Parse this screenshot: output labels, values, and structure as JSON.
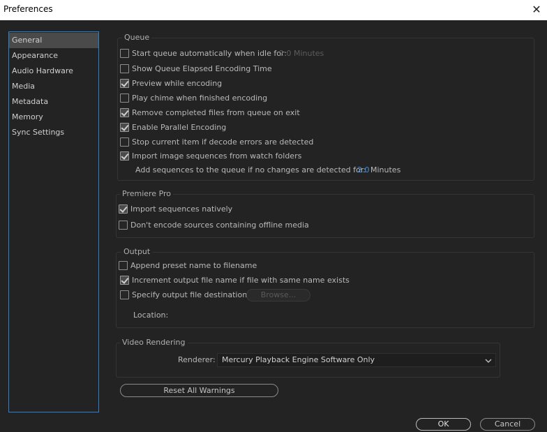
{
  "window": {
    "title": "Preferences",
    "close_glyph": "✕"
  },
  "sidebar": {
    "items": [
      {
        "label": "General",
        "active": true
      },
      {
        "label": "Appearance"
      },
      {
        "label": "Audio Hardware"
      },
      {
        "label": "Media"
      },
      {
        "label": "Metadata"
      },
      {
        "label": "Memory"
      },
      {
        "label": "Sync Settings"
      }
    ]
  },
  "queue": {
    "title": "Queue",
    "start_auto": {
      "label": "Start queue automatically when idle for:",
      "checked": false,
      "value": "2.0 Minutes"
    },
    "show_elapsed": {
      "label": "Show Queue Elapsed Encoding Time",
      "checked": false
    },
    "preview": {
      "label": "Preview while encoding",
      "checked": true
    },
    "chime": {
      "label": "Play chime when finished encoding",
      "checked": false
    },
    "remove_completed": {
      "label": "Remove completed files from queue on exit",
      "checked": true
    },
    "parallel": {
      "label": "Enable Parallel Encoding",
      "checked": true
    },
    "stop_current": {
      "label": "Stop current item if decode errors are detected",
      "checked": false
    },
    "import_watch": {
      "label": "Import image sequences from watch folders",
      "checked": true
    },
    "add_sequences": {
      "label": "Add sequences to the queue if no changes are detected for:",
      "value": "2.0",
      "unit": "Minutes"
    }
  },
  "premiere": {
    "title": "Premiere Pro",
    "import_native": {
      "label": "Import sequences natively",
      "checked": true
    },
    "dont_encode": {
      "label": "Don't encode sources containing offline media",
      "checked": false
    }
  },
  "output": {
    "title": "Output",
    "append_preset": {
      "label": "Append preset name to filename",
      "checked": false
    },
    "increment": {
      "label": "Increment output file name if file with same name exists",
      "checked": true
    },
    "specify": {
      "label": "Specify output file destination:",
      "checked": false
    },
    "browse_label": "Browse...",
    "location_label": "Location:"
  },
  "video_rendering": {
    "title": "Video Rendering",
    "renderer_label": "Renderer:",
    "renderer_value": "Mercury Playback Engine Software Only"
  },
  "buttons": {
    "reset_warnings": "Reset All Warnings",
    "ok": "OK",
    "cancel": "Cancel"
  }
}
